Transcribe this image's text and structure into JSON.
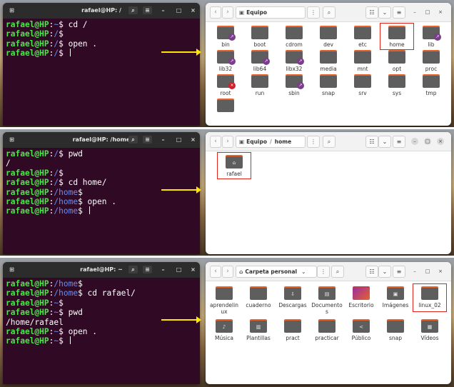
{
  "panels": [
    {
      "terminal": {
        "title": "rafael@HP: /",
        "lines": [
          [
            {
              "t": "rafael@HP",
              "c": "u"
            },
            {
              "t": ":",
              "c": ""
            },
            {
              "t": "~",
              "c": "p"
            },
            {
              "t": "$ cd /",
              "c": ""
            }
          ],
          [
            {
              "t": "rafael@HP",
              "c": "u"
            },
            {
              "t": ":",
              "c": ""
            },
            {
              "t": "/",
              "c": "p"
            },
            {
              "t": "$",
              "c": ""
            }
          ],
          [
            {
              "t": "rafael@HP",
              "c": "u"
            },
            {
              "t": ":",
              "c": ""
            },
            {
              "t": "/",
              "c": "p"
            },
            {
              "t": "$ open .",
              "c": ""
            }
          ],
          [
            {
              "t": "rafael@HP",
              "c": "u"
            },
            {
              "t": ":",
              "c": ""
            },
            {
              "t": "/",
              "c": "p"
            },
            {
              "t": "$ ",
              "c": ""
            },
            {
              "t": "",
              "c": "cursor"
            }
          ]
        ]
      },
      "files": {
        "path": "Equipo",
        "items": [
          {
            "name": "bin",
            "badge": "link"
          },
          {
            "name": "boot"
          },
          {
            "name": "cdrom"
          },
          {
            "name": "dev"
          },
          {
            "name": "etc"
          },
          {
            "name": "home",
            "selected": true
          },
          {
            "name": "lib",
            "badge": "link"
          },
          {
            "name": "lib32",
            "badge": "link"
          },
          {
            "name": "lib64",
            "badge": "link"
          },
          {
            "name": "libx32",
            "badge": "link"
          },
          {
            "name": "media"
          },
          {
            "name": "mnt"
          },
          {
            "name": "opt"
          },
          {
            "name": "proc"
          },
          {
            "name": "root",
            "badge": "no"
          },
          {
            "name": "run"
          },
          {
            "name": "sbin",
            "badge": "link"
          },
          {
            "name": "snap"
          },
          {
            "name": "srv"
          },
          {
            "name": "sys"
          },
          {
            "name": "tmp"
          },
          {
            "name": ""
          }
        ]
      }
    },
    {
      "terminal": {
        "title": "rafael@HP: /home",
        "lines": [
          [
            {
              "t": "rafael@HP",
              "c": "u"
            },
            {
              "t": ":",
              "c": ""
            },
            {
              "t": "/",
              "c": "p"
            },
            {
              "t": "$ pwd",
              "c": ""
            }
          ],
          [
            {
              "t": "/",
              "c": ""
            }
          ],
          [
            {
              "t": "rafael@HP",
              "c": "u"
            },
            {
              "t": ":",
              "c": ""
            },
            {
              "t": "/",
              "c": "p"
            },
            {
              "t": "$",
              "c": ""
            }
          ],
          [
            {
              "t": "rafael@HP",
              "c": "u"
            },
            {
              "t": ":",
              "c": ""
            },
            {
              "t": "/",
              "c": "p"
            },
            {
              "t": "$ cd home/",
              "c": ""
            }
          ],
          [
            {
              "t": "rafael@HP",
              "c": "u"
            },
            {
              "t": ":",
              "c": ""
            },
            {
              "t": "/home",
              "c": "p"
            },
            {
              "t": "$",
              "c": ""
            }
          ],
          [
            {
              "t": "rafael@HP",
              "c": "u"
            },
            {
              "t": ":",
              "c": ""
            },
            {
              "t": "/home",
              "c": "p"
            },
            {
              "t": "$ open .",
              "c": ""
            }
          ],
          [
            {
              "t": "rafael@HP",
              "c": "u"
            },
            {
              "t": ":",
              "c": ""
            },
            {
              "t": "/home",
              "c": "p"
            },
            {
              "t": "$ ",
              "c": ""
            },
            {
              "t": "",
              "c": "cursor"
            }
          ]
        ]
      },
      "files": {
        "path": "Equipo",
        "path2": "home",
        "items": [
          {
            "name": "rafael",
            "selected": true,
            "emblem": "⌂"
          }
        ]
      }
    },
    {
      "terminal": {
        "title": "rafael@HP: ~",
        "lines": [
          [
            {
              "t": "rafael@HP",
              "c": "u"
            },
            {
              "t": ":",
              "c": ""
            },
            {
              "t": "/home",
              "c": "p"
            },
            {
              "t": "$",
              "c": ""
            }
          ],
          [
            {
              "t": "rafael@HP",
              "c": "u"
            },
            {
              "t": ":",
              "c": ""
            },
            {
              "t": "/home",
              "c": "p"
            },
            {
              "t": "$ cd rafael/",
              "c": ""
            }
          ],
          [
            {
              "t": "rafael@HP",
              "c": "u"
            },
            {
              "t": ":",
              "c": ""
            },
            {
              "t": "~",
              "c": "p"
            },
            {
              "t": "$",
              "c": ""
            }
          ],
          [
            {
              "t": "rafael@HP",
              "c": "u"
            },
            {
              "t": ":",
              "c": ""
            },
            {
              "t": "~",
              "c": "p"
            },
            {
              "t": "$ pwd",
              "c": ""
            }
          ],
          [
            {
              "t": "/home/rafael",
              "c": ""
            }
          ],
          [
            {
              "t": "rafael@HP",
              "c": "u"
            },
            {
              "t": ":",
              "c": ""
            },
            {
              "t": "~",
              "c": "p"
            },
            {
              "t": "$ open .",
              "c": ""
            }
          ],
          [
            {
              "t": "rafael@HP",
              "c": "u"
            },
            {
              "t": ":",
              "c": ""
            },
            {
              "t": "~",
              "c": "p"
            },
            {
              "t": "$ ",
              "c": ""
            },
            {
              "t": "",
              "c": "cursor"
            }
          ]
        ]
      },
      "files": {
        "path": "Carpeta personal",
        "items": [
          {
            "name": "aprendelinux",
            "label": "aprendelin\nux"
          },
          {
            "name": "cuaderno"
          },
          {
            "name": "Descargas",
            "emblem": "⇩"
          },
          {
            "name": "Documentos",
            "label": "Documento\ns",
            "emblem": "▤"
          },
          {
            "name": "Escritorio",
            "special": "desktop"
          },
          {
            "name": "Imágenes",
            "emblem": "▣"
          },
          {
            "name": "linux_02",
            "selected": true
          },
          {
            "name": "Música",
            "emblem": "♪"
          },
          {
            "name": "Plantillas",
            "emblem": "▥"
          },
          {
            "name": "pract"
          },
          {
            "name": "practicar"
          },
          {
            "name": "Público",
            "emblem": "<"
          },
          {
            "name": "snap"
          },
          {
            "name": "Vídeos",
            "emblem": "▦"
          }
        ]
      }
    }
  ],
  "colors": {
    "accent": "#e2231a",
    "arrow": "#ffe600",
    "terminal_bg": "#300a24",
    "user": "#4ee44e",
    "path": "#6a8df0"
  }
}
